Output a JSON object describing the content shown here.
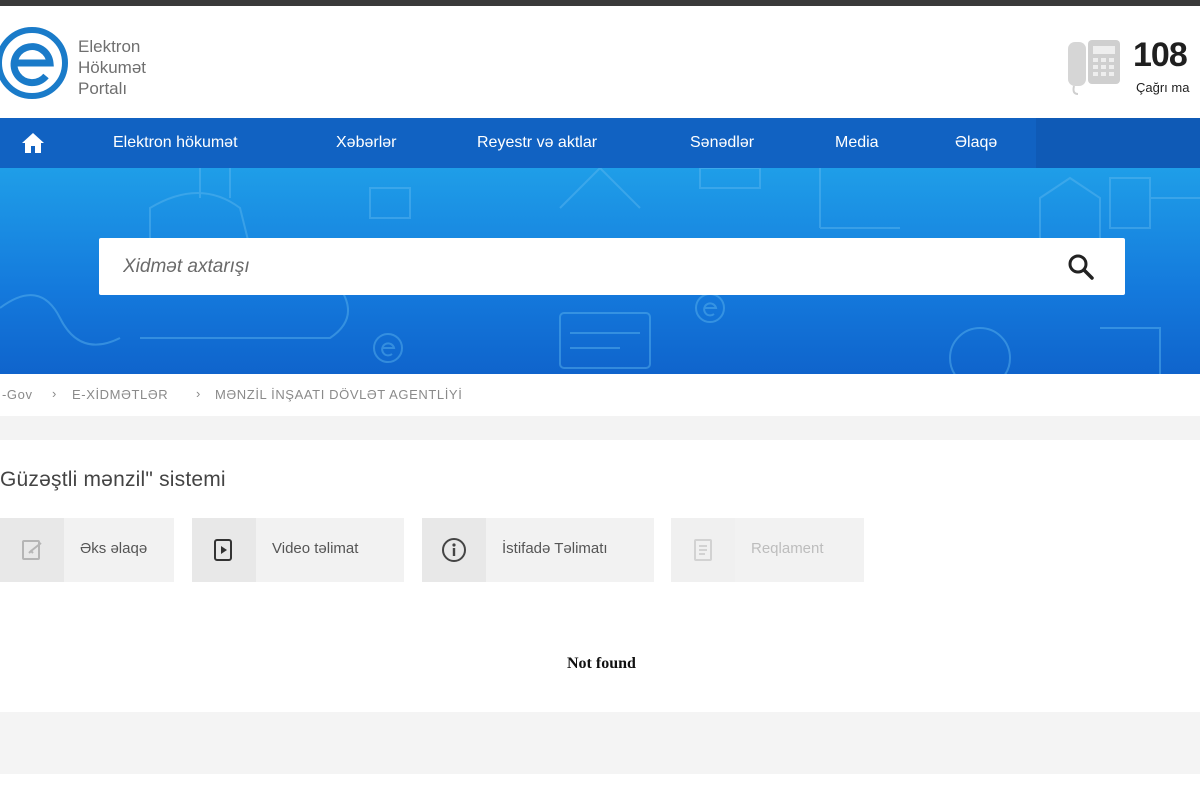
{
  "header": {
    "logo_lines": [
      "Elektron",
      "Hökumət",
      "Portalı"
    ],
    "phone_number": "108",
    "phone_label": "Çağrı ma"
  },
  "nav": {
    "items": [
      {
        "label": "Elektron hökumət"
      },
      {
        "label": "Xəbərlər"
      },
      {
        "label": "Reyestr və aktlar"
      },
      {
        "label": "Sənədlər"
      },
      {
        "label": "Media"
      },
      {
        "label": "Əlaqə"
      }
    ]
  },
  "search": {
    "placeholder": "Xidmət axtarışı"
  },
  "breadcrumb": {
    "items": [
      "-Gov",
      "E-XİDMƏTLƏR",
      "MƏNZİL İNŞAATI DÖVLƏT AGENTLİYİ"
    ],
    "separator": "›"
  },
  "page": {
    "title": "Güzəştli mənzil\" sistemi",
    "not_found": "Not found"
  },
  "tools": [
    {
      "label": "Əks əlaqə",
      "icon": "feedback-icon",
      "enabled": true
    },
    {
      "label": "Video təlimat",
      "icon": "video-icon",
      "enabled": true
    },
    {
      "label": "İstifadə Təlimatı",
      "icon": "info-icon",
      "enabled": true
    },
    {
      "label": "Reqlament",
      "icon": "document-icon",
      "enabled": false
    }
  ],
  "colors": {
    "nav_blue": "#1162c2",
    "hero_top": "#1f9ee8",
    "hero_bottom": "#0f64cc",
    "logo_blue": "#1a7bc9"
  }
}
